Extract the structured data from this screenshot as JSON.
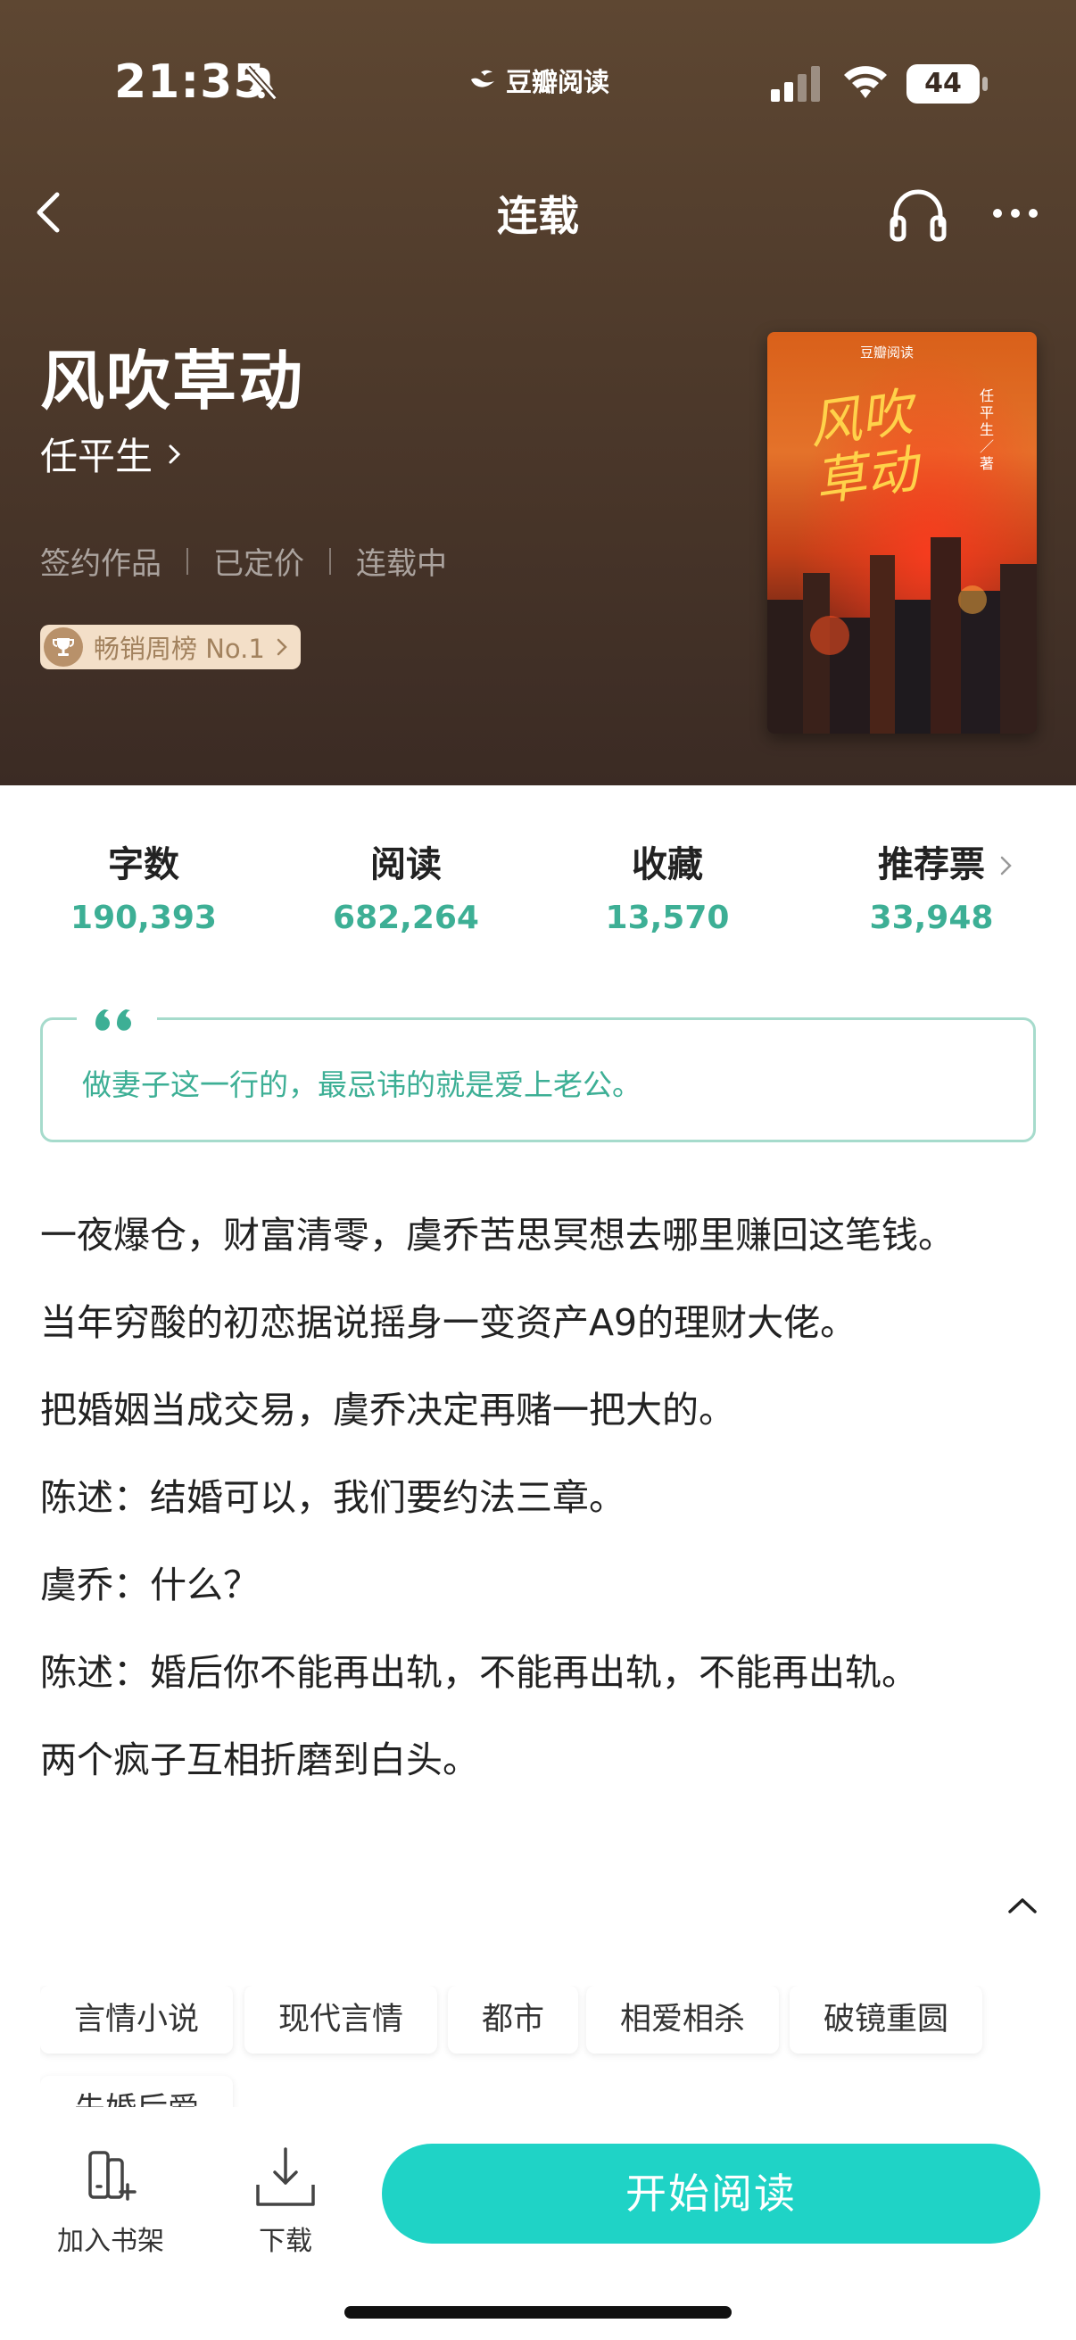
{
  "status_bar": {
    "time": "21:35",
    "carrier": "豆瓣阅读",
    "battery": "44"
  },
  "nav": {
    "title": "连载"
  },
  "book": {
    "title": "风吹草动",
    "author": "任平生",
    "meta": [
      "签约作品",
      "已定价",
      "连载中"
    ],
    "rank_badge": "畅销周榜 No.1",
    "cover": {
      "brand": "豆瓣阅读",
      "title_line1": "风吹",
      "title_line2": "草动",
      "author_note": "任平生／著"
    }
  },
  "stats": [
    {
      "label": "字数",
      "value": "190,393"
    },
    {
      "label": "阅读",
      "value": "682,264"
    },
    {
      "label": "收藏",
      "value": "13,570"
    },
    {
      "label": "推荐票",
      "value": "33,948"
    }
  ],
  "quote": "做妻子这一行的，最忌讳的就是爱上老公。",
  "description": [
    "一夜爆仓，财富清零，虞乔苦思冥想去哪里赚回这笔钱。",
    "当年穷酸的初恋据说摇身一变资产A9的理财大佬。",
    "把婚姻当成交易，虞乔决定再赌一把大的。",
    "陈述：结婚可以，我们要约法三章。",
    "虞乔：什么？",
    "陈述：婚后你不能再出轨，不能再出轨，不能再出轨。",
    "两个疯子互相折磨到白头。"
  ],
  "tags": [
    "言情小说",
    "现代言情",
    "都市",
    "相爱相杀",
    "破镜重圆",
    "先婚后爱"
  ],
  "bottom": {
    "shelf_label": "加入书架",
    "download_label": "下载",
    "read_label": "开始阅读"
  },
  "colors": {
    "accent": "#1fd3c6",
    "stat_green": "#3daf95",
    "hero_bg": "#4e3a2b"
  }
}
